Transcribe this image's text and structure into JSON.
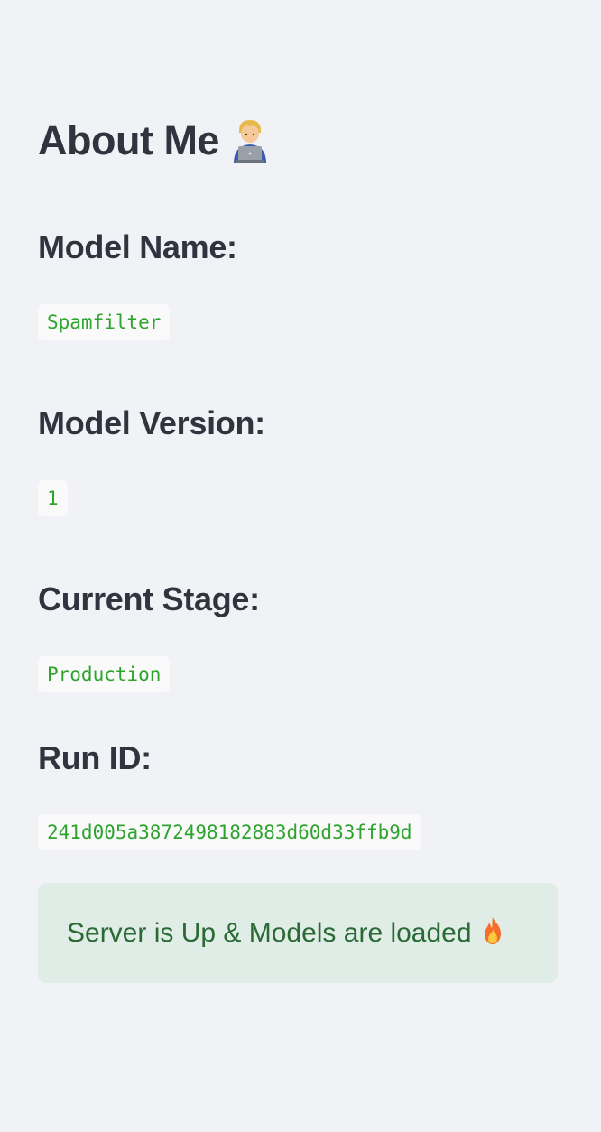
{
  "header": {
    "title": "About Me",
    "title_emoji": "technologist-icon"
  },
  "model_name": {
    "label": "Model Name:",
    "value": "Spamfilter"
  },
  "model_version": {
    "label": "Model Version:",
    "value": "1"
  },
  "current_stage": {
    "label": "Current Stage:",
    "value": "Production"
  },
  "run_id": {
    "label": "Run ID:",
    "value": "241d005a3872498182883d60d33ffb9d"
  },
  "status": {
    "message": "Server is Up & Models are loaded",
    "icon": "fire-icon",
    "colors": {
      "background": "#dfede6",
      "text": "#2b6a35"
    }
  },
  "colors": {
    "page_background": "#f0f2f6",
    "heading": "#31333f",
    "code_text": "#2ea32e",
    "code_background": "#fafafb"
  }
}
